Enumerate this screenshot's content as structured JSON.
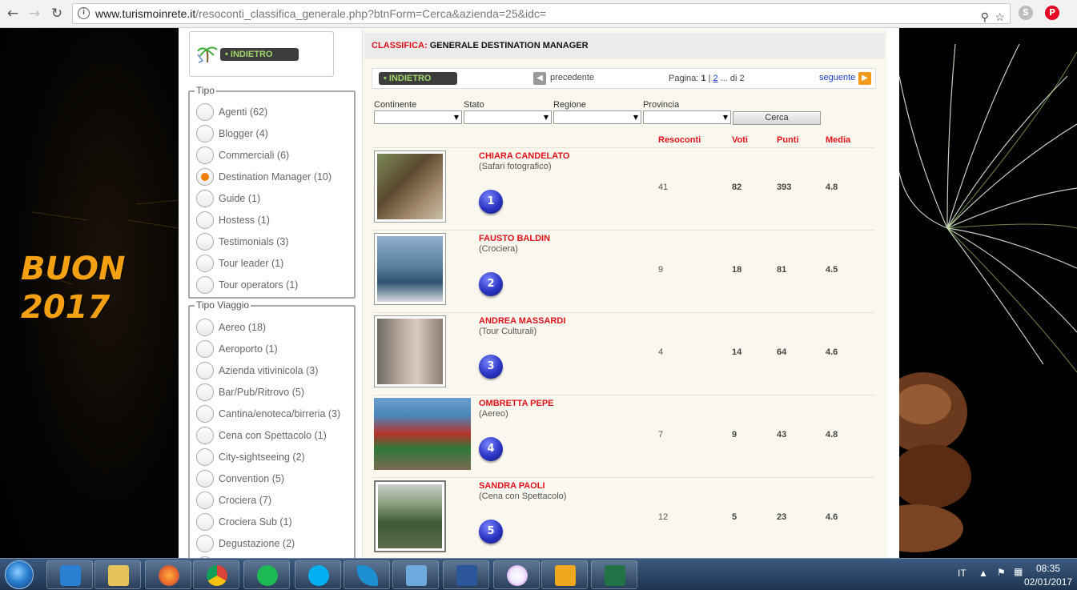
{
  "browser": {
    "url_host": "www.turismoinrete.it",
    "url_path": "/resoconti_classifica_generale.php?btnForm=Cerca&azienda=25&idc="
  },
  "banner_text": [
    "BUON",
    "2017"
  ],
  "logo": {
    "back_label": "• INDIETRO"
  },
  "tipo": {
    "legend": "Tipo",
    "options": [
      {
        "label": "Agenti (62)",
        "selected": false
      },
      {
        "label": "Blogger (4)",
        "selected": false
      },
      {
        "label": "Commerciali (6)",
        "selected": false
      },
      {
        "label": "Destination Manager (10)",
        "selected": true
      },
      {
        "label": "Guide (1)",
        "selected": false
      },
      {
        "label": "Hostess (1)",
        "selected": false
      },
      {
        "label": "Testimonials (3)",
        "selected": false
      },
      {
        "label": "Tour leader (1)",
        "selected": false
      },
      {
        "label": "Tour operators (1)",
        "selected": false
      }
    ]
  },
  "tipo_viaggio": {
    "legend": "Tipo Viaggio",
    "options": [
      "Aereo (18)",
      "Aeroporto (1)",
      "Azienda vitivinicola (3)",
      "Bar/Pub/Ritrovo (5)",
      "Cantina/enoteca/birreria (3)",
      "Cena con Spettacolo (1)",
      "City-sightseeing (2)",
      "Convention (5)",
      "Crociera (7)",
      "Crociera Sub (1)",
      "Degustazione (2)"
    ]
  },
  "main": {
    "title_prefix": "CLASSIFICA:",
    "title_rest": "GENERALE DESTINATION MANAGER",
    "pager": {
      "back_label": "• INDIETRO",
      "prev_label": "precedente",
      "page_label": "Pagina:",
      "current": "1",
      "sep": "|",
      "next_page": "2",
      "of_label": "... di 2",
      "next_label": "seguente"
    },
    "filters": {
      "continente": "Continente",
      "stato": "Stato",
      "regione": "Regione",
      "provincia": "Provincia",
      "search_label": "Cerca"
    },
    "columns": {
      "resoconti": "Resoconti",
      "voti": "Voti",
      "punti": "Punti",
      "media": "Media"
    },
    "rows": [
      {
        "rank": "1",
        "name": "CHIARA CANDELATO",
        "category": "(Safari fotografico)",
        "resoconti": "41",
        "voti": "82",
        "punti": "393",
        "media": "4.8"
      },
      {
        "rank": "2",
        "name": "FAUSTO BALDIN",
        "category": "(Crociera)",
        "resoconti": "9",
        "voti": "18",
        "punti": "81",
        "media": "4.5"
      },
      {
        "rank": "3",
        "name": "ANDREA MASSARDI",
        "category": "(Tour Culturali)",
        "resoconti": "4",
        "voti": "14",
        "punti": "64",
        "media": "4.6"
      },
      {
        "rank": "4",
        "name": "OMBRETTA PEPE",
        "category": "(Aereo)",
        "resoconti": "7",
        "voti": "9",
        "punti": "43",
        "media": "4.8"
      },
      {
        "rank": "5",
        "name": "SANDRA PAOLI",
        "category": "(Cena con Spettacolo)",
        "resoconti": "12",
        "voti": "5",
        "punti": "23",
        "media": "4.6"
      }
    ]
  },
  "taskbar": {
    "language": "IT",
    "time": "08:35",
    "date": "02/01/2017",
    "apps": [
      "media-player-icon",
      "file-explorer-icon",
      "firefox-icon",
      "chrome-icon",
      "spotify-icon",
      "skype-icon",
      "feather-icon",
      "photo-viewer-icon",
      "word-icon",
      "itunes-icon",
      "outlook-icon",
      "excel-icon"
    ]
  },
  "colors": {
    "accent_red": "#e0121a",
    "accent_orange": "#f07e00",
    "banner_gold": "#f3a012"
  }
}
